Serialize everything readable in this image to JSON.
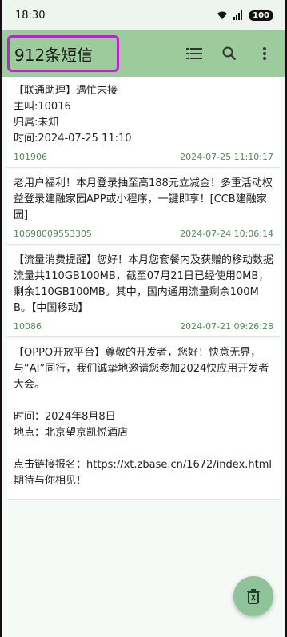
{
  "status_bar": {
    "time": "18:30",
    "signal_text": "5⁄⁄",
    "battery": "100"
  },
  "app_bar": {
    "title": "912条短信"
  },
  "messages": [
    {
      "body": "【联通助理】遇忙未接\n主叫:10016\n归属:未知\n时间:2024-07-25 11:10\n",
      "sender": "101906",
      "time": "2024-07-25 11:10:17"
    },
    {
      "body": "老用户福利！本月登录抽至高188元立减金！多重活动权益登录建融家园APP或小程序，一键即享！[CCB建融家园]",
      "sender": "10698009553305",
      "time": "2024-07-24 10:06:14"
    },
    {
      "body": "【流量消费提醒】您好！本月您套餐内及获赠的移动数据流量共110GB100MB，截至07月21日已经使用0MB，剩余110GB100MB。其中，国内通用流量剩余100MB。【中国移动】",
      "sender": "10086",
      "time": "2024-07-21 09:26:28"
    },
    {
      "body": "【OPPO开放平台】尊敬的开发者，您好！快意无界，与“AI”同行，我们诚挚地邀请您参加2024快应用开发者大会。\n\n时间：2024年8月8日\n地点：北京望京凯悦酒店\n\n点击链接报名：https://xt.zbase.cn/1672/index.html\n期待与你相见！",
      "sender": "",
      "time": ""
    }
  ],
  "icons": {
    "list": "list-icon",
    "search": "search-icon",
    "more": "more-vert-icon",
    "delete": "trash-icon"
  },
  "colors": {
    "app_bar": "#9ccc9c",
    "highlight": "#c41fd0",
    "meta_text": "#4f8a5a",
    "fab": "#8fc49a"
  }
}
